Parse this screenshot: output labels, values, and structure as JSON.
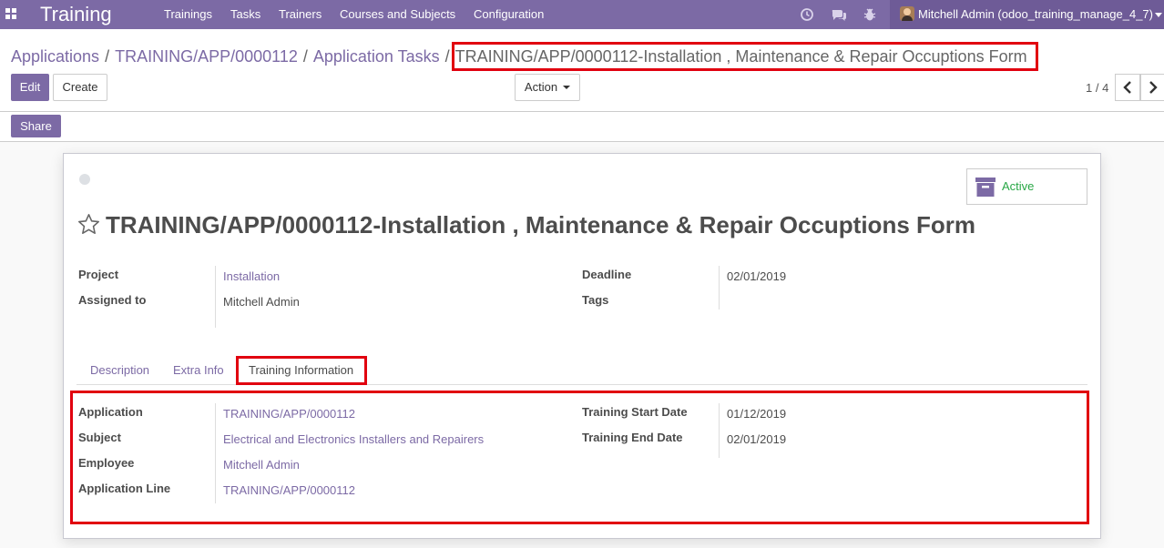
{
  "navbar": {
    "brand": "Training",
    "menu": [
      "Trainings",
      "Tasks",
      "Trainers",
      "Courses and Subjects",
      "Configuration"
    ],
    "icons": [
      "clock-icon",
      "chat-icon",
      "bug-icon"
    ],
    "user": "Mitchell Admin (odoo_training_manage_4_7)"
  },
  "breadcrumb": {
    "items": [
      "Applications",
      "TRAINING/APP/0000112",
      "Application Tasks"
    ],
    "separator": "/",
    "current": "TRAINING/APP/0000112-Installation , Maintenance & Repair Occuptions Form"
  },
  "toolbar": {
    "edit_label": "Edit",
    "create_label": "Create",
    "action_label": "Action",
    "pager": "1 / 4"
  },
  "statusbar": {
    "share_label": "Share"
  },
  "form": {
    "archive_label": "Active",
    "title": "TRAINING/APP/0000112-Installation , Maintenance & Repair Occuptions Form",
    "project_label": "Project",
    "project_value": "Installation",
    "assigned_label": "Assigned to",
    "assigned_value": "Mitchell Admin",
    "deadline_label": "Deadline",
    "deadline_value": "02/01/2019",
    "tags_label": "Tags",
    "tags_value": ""
  },
  "tabs": {
    "items": [
      "Description",
      "Extra Info",
      "Training Information"
    ],
    "active": "Training Information"
  },
  "training_info": {
    "application_label": "Application",
    "application_value": "TRAINING/APP/0000112",
    "subject_label": "Subject",
    "subject_value": "Electrical and Electronics Installers and Repairers",
    "employee_label": "Employee",
    "employee_value": "Mitchell Admin",
    "app_line_label": "Application Line",
    "app_line_value": "TRAINING/APP/0000112",
    "start_label": "Training Start Date",
    "start_value": "01/12/2019",
    "end_label": "Training End Date",
    "end_value": "02/01/2019"
  },
  "colors": {
    "brand": "#7c6aa5",
    "user_block": "#6e5b97",
    "link": "#7c6aa5",
    "active_status": "#28a745",
    "highlight": "#e1000f"
  }
}
